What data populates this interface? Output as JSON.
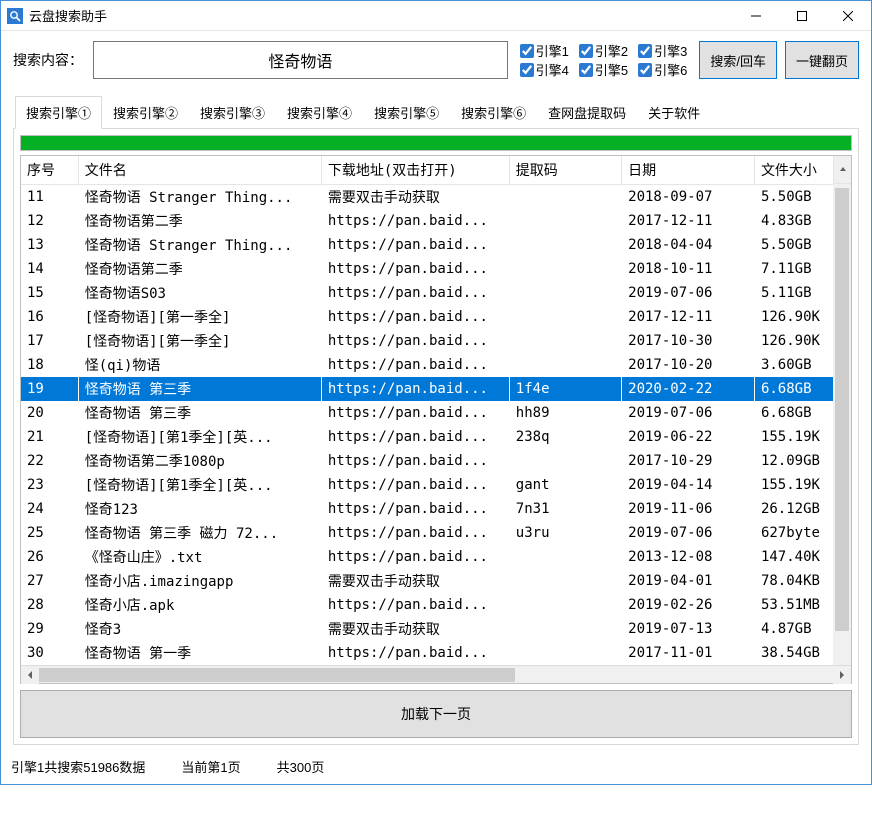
{
  "window": {
    "title": "云盘搜索助手"
  },
  "search": {
    "label": "搜索内容：",
    "value": "怪奇物语",
    "engines": [
      "引擎1",
      "引擎2",
      "引擎3",
      "引擎4",
      "引擎5",
      "引擎6"
    ],
    "btn_search": "搜索/回车",
    "btn_page": "一键翻页"
  },
  "tabs": [
    "搜索引擎①",
    "搜索引擎②",
    "搜索引擎③",
    "搜索引擎④",
    "搜索引擎⑤",
    "搜索引擎⑥",
    "查网盘提取码",
    "关于软件"
  ],
  "columns": {
    "seq": "序号",
    "name": "文件名",
    "url": "下载地址(双击打开)",
    "code": "提取码",
    "date": "日期",
    "size": "文件大小"
  },
  "selected_index": 8,
  "rows": [
    {
      "seq": "11",
      "name": "怪奇物语 Stranger Thing...",
      "url": "需要双击手动获取",
      "code": "",
      "date": "2018-09-07",
      "size": "5.50GB"
    },
    {
      "seq": "12",
      "name": "怪奇物语第二季",
      "url": "https://pan.baid...",
      "code": "",
      "date": "2017-12-11",
      "size": "4.83GB"
    },
    {
      "seq": "13",
      "name": "怪奇物语 Stranger Thing...",
      "url": "https://pan.baid...",
      "code": "",
      "date": "2018-04-04",
      "size": "5.50GB"
    },
    {
      "seq": "14",
      "name": "怪奇物语第二季",
      "url": "https://pan.baid...",
      "code": "",
      "date": "2018-10-11",
      "size": "7.11GB"
    },
    {
      "seq": "15",
      "name": "怪奇物语S03",
      "url": "https://pan.baid...",
      "code": "",
      "date": "2019-07-06",
      "size": "5.11GB"
    },
    {
      "seq": "16",
      "name": "[怪奇物语][第一季全]",
      "url": "https://pan.baid...",
      "code": "",
      "date": "2017-12-11",
      "size": "126.90K"
    },
    {
      "seq": "17",
      "name": "[怪奇物语][第一季全]",
      "url": "https://pan.baid...",
      "code": "",
      "date": "2017-10-30",
      "size": "126.90K"
    },
    {
      "seq": "18",
      "name": "怪(qi)物语",
      "url": "https://pan.baid...",
      "code": "",
      "date": "2017-10-20",
      "size": "3.60GB"
    },
    {
      "seq": "19",
      "name": "怪奇物语 第三季",
      "url": "https://pan.baid...",
      "code": "1f4e",
      "date": "2020-02-22",
      "size": "6.68GB"
    },
    {
      "seq": "20",
      "name": "怪奇物语 第三季",
      "url": "https://pan.baid...",
      "code": "hh89",
      "date": "2019-07-06",
      "size": "6.68GB"
    },
    {
      "seq": "21",
      "name": "[怪奇物语][第1季全][英...",
      "url": "https://pan.baid...",
      "code": "238q",
      "date": "2019-06-22",
      "size": "155.19K"
    },
    {
      "seq": "22",
      "name": "怪奇物语第二季1080p",
      "url": "https://pan.baid...",
      "code": "",
      "date": "2017-10-29",
      "size": "12.09GB"
    },
    {
      "seq": "23",
      "name": "[怪奇物语][第1季全][英...",
      "url": "https://pan.baid...",
      "code": "gant",
      "date": "2019-04-14",
      "size": "155.19K"
    },
    {
      "seq": "24",
      "name": "怪奇123",
      "url": "https://pan.baid...",
      "code": "7n31",
      "date": "2019-11-06",
      "size": "26.12GB"
    },
    {
      "seq": "25",
      "name": "怪奇物语 第三季 磁力 72...",
      "url": "https://pan.baid...",
      "code": "u3ru",
      "date": "2019-07-06",
      "size": "627byte"
    },
    {
      "seq": "26",
      "name": "《怪奇山庄》.txt",
      "url": "https://pan.baid...",
      "code": "",
      "date": "2013-12-08",
      "size": "147.40K"
    },
    {
      "seq": "27",
      "name": "怪奇小店.imazingapp",
      "url": "需要双击手动获取",
      "code": "",
      "date": "2019-04-01",
      "size": "78.04KB"
    },
    {
      "seq": "28",
      "name": "怪奇小店.apk",
      "url": "https://pan.baid...",
      "code": "",
      "date": "2019-02-26",
      "size": "53.51MB"
    },
    {
      "seq": "29",
      "name": "怪奇3",
      "url": "需要双击手动获取",
      "code": "",
      "date": "2019-07-13",
      "size": "4.87GB"
    },
    {
      "seq": "30",
      "name": "怪奇物语 第一季",
      "url": "https://pan.baid...",
      "code": "",
      "date": "2017-11-01",
      "size": "38.54GB"
    }
  ],
  "load_more": "加载下一页",
  "status": {
    "total": "引擎1共搜索51986数据",
    "current": "当前第1页",
    "pages": "共300页"
  }
}
